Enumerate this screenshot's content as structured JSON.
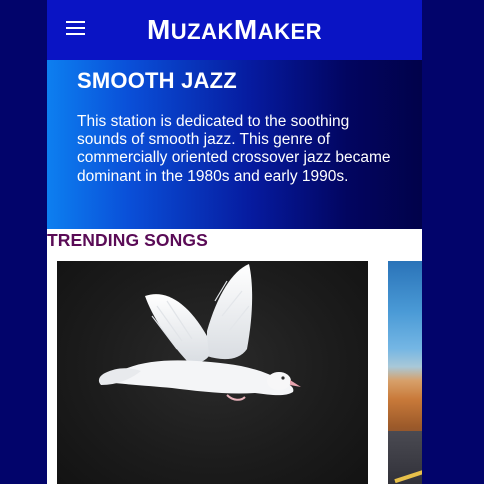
{
  "header": {
    "menu_icon": "hamburger-menu-icon",
    "brand_parts": [
      {
        "text": "M",
        "big": true
      },
      {
        "text": "UZAK",
        "big": false
      },
      {
        "text": "M",
        "big": true
      },
      {
        "text": "AKER",
        "big": false
      }
    ]
  },
  "station": {
    "title": "SMOOTH JAZZ",
    "description": "This station is dedicated to the soothing sounds of smooth jazz. This genre of commercially oriented crossover jazz became dominant in the 1980s and early 1990s."
  },
  "trending": {
    "title": "TRENDING SONGS",
    "cards": [
      {
        "image": "white-dove-flying-image"
      },
      {
        "image": "desert-road-landscape-image"
      }
    ]
  },
  "colors": {
    "page_background": "#02046b",
    "topbar": "#0a14c4",
    "section_title": "#5a0b56"
  }
}
